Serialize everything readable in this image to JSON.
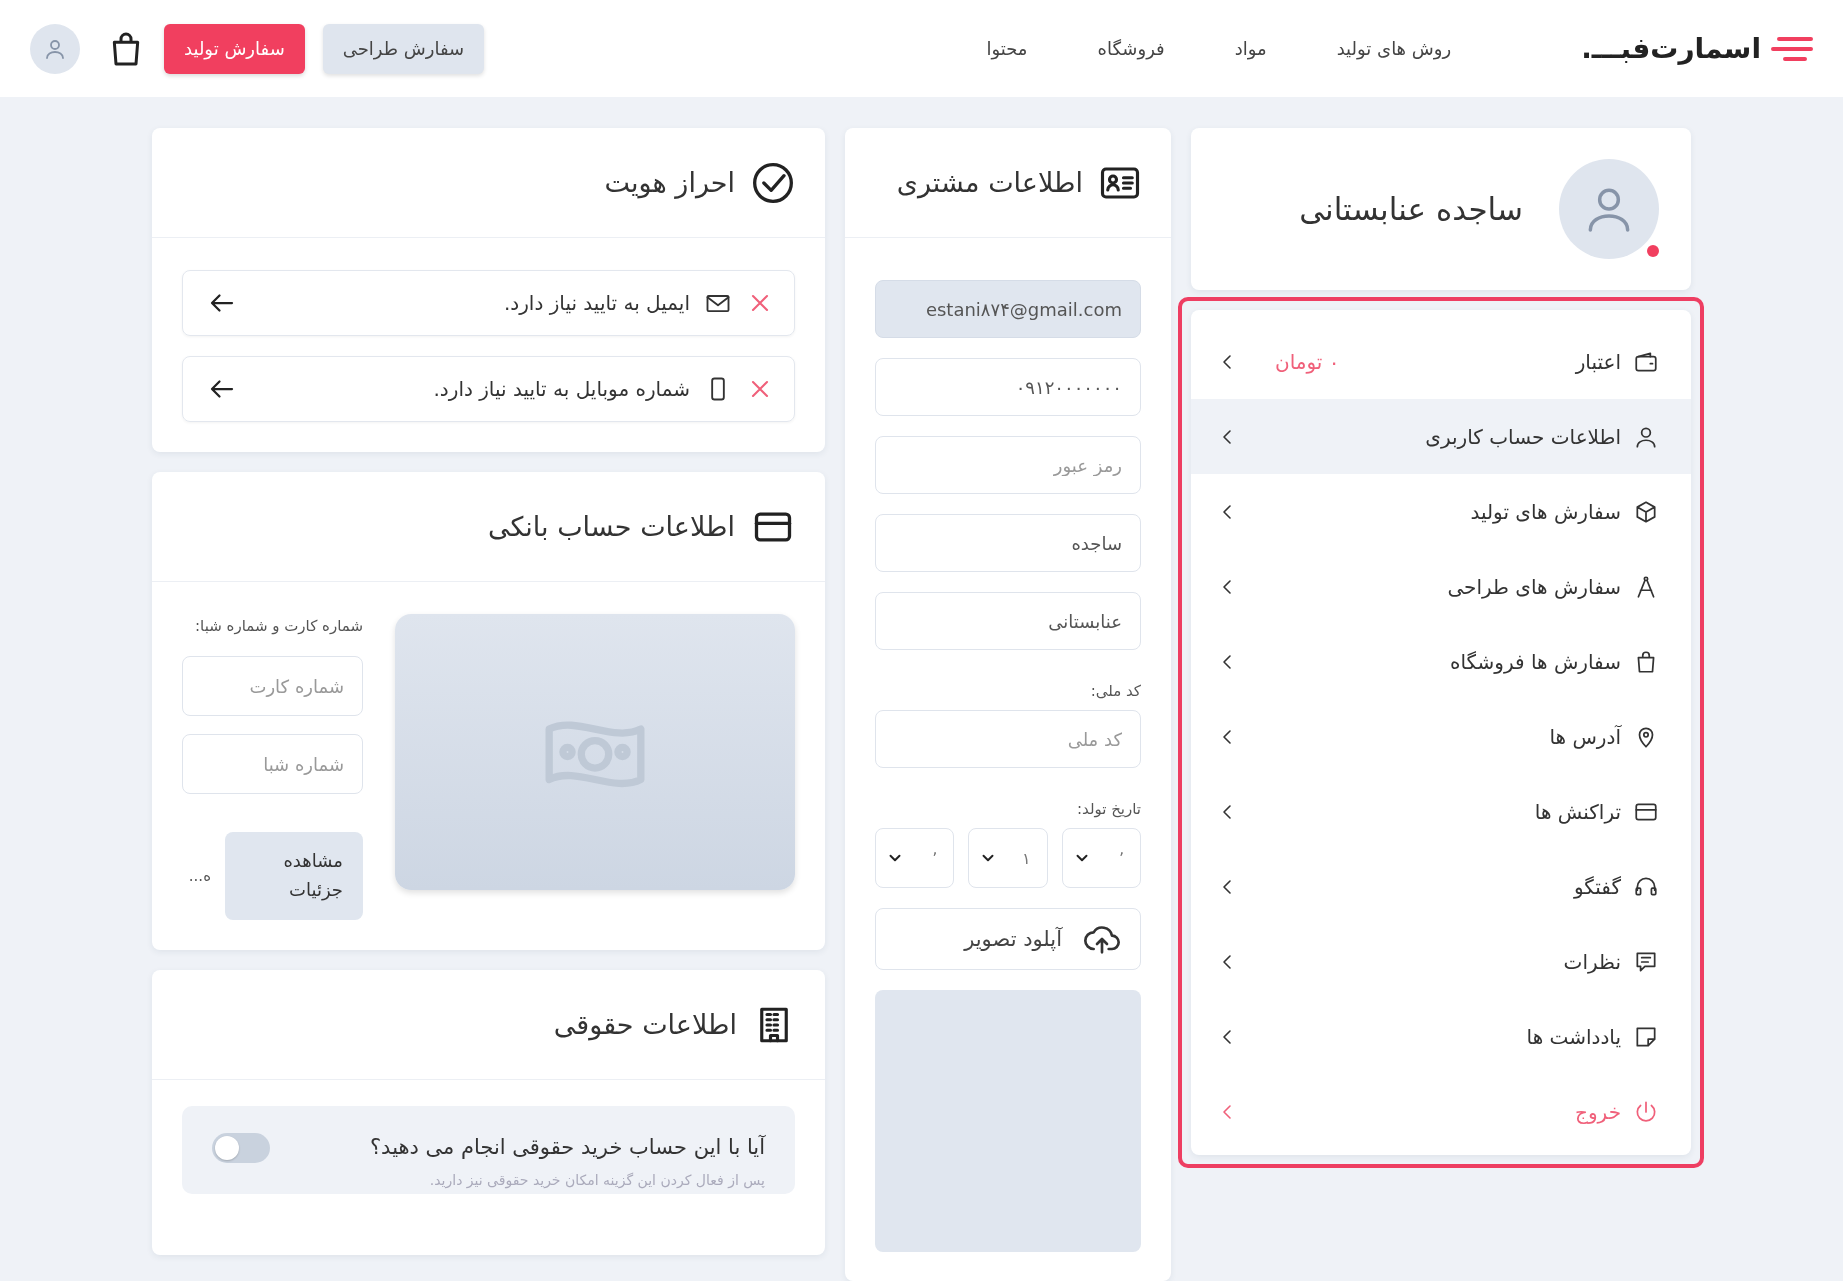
{
  "header": {
    "logo": "اسمارت‌فبـــ.",
    "nav": [
      "روش های تولید",
      "مواد",
      "فروشگاه",
      "محتوا"
    ],
    "buttons": [
      {
        "label": "سفارش طراحی",
        "kind": "secondary"
      },
      {
        "label": "سفارش تولید",
        "kind": "primary"
      }
    ]
  },
  "profile": {
    "name": "ساجده عنابستانی",
    "alert": true
  },
  "account_menu": {
    "highlighted": true,
    "items": [
      {
        "label": "اعتبار",
        "value": "۰ تومان",
        "selected": false,
        "kind": "normal"
      },
      {
        "label": "اطلاعات حساب کاربری",
        "selected": true,
        "kind": "normal"
      },
      {
        "label": "سفارش های تولید",
        "selected": false,
        "kind": "normal"
      },
      {
        "label": "سفارش های طراحی",
        "selected": false,
        "kind": "normal"
      },
      {
        "label": "سفارش ها فروشگاه",
        "selected": false,
        "kind": "normal"
      },
      {
        "label": "آدرس ها",
        "selected": false,
        "kind": "normal"
      },
      {
        "label": "تراکنش ها",
        "selected": false,
        "kind": "normal"
      },
      {
        "label": "گفتگو",
        "selected": false,
        "kind": "normal"
      },
      {
        "label": "نظرات",
        "selected": false,
        "kind": "normal"
      },
      {
        "label": "یادداشت ها",
        "selected": false,
        "kind": "normal"
      },
      {
        "label": "خروج",
        "selected": false,
        "kind": "logout"
      }
    ]
  },
  "customer_info": {
    "title": "اطلاعات مشتری",
    "fields": [
      {
        "value": "estani۸۷۴@gmail.com",
        "disabled": true
      },
      {
        "value": "۰۹۱۲۰۰۰۰۰۰۰",
        "disabled": false
      },
      {
        "placeholder": "رمز عبور",
        "disabled": false
      },
      {
        "value": "ساجده",
        "disabled": false
      },
      {
        "value": "عنابستانی",
        "disabled": false
      }
    ],
    "national_id": {
      "label": "کد ملی:",
      "placeholder": "کد ملی"
    },
    "birth_date": {
      "label": "تاریخ تولد:",
      "selects": [
        "٬",
        "۱",
        "٬"
      ]
    },
    "upload": {
      "label": "آپلود تصویر"
    }
  },
  "identity": {
    "title": "احراز هویت",
    "items": [
      {
        "text": "ایمیل به تایید نیاز دارد.",
        "verified": false
      },
      {
        "text": "شماره موبایل به تایید نیاز دارد.",
        "verified": false
      }
    ]
  },
  "bank": {
    "title": "اطلاعات حساب بانکی",
    "label": "شماره کارت و شماره شبا:",
    "fields": [
      {
        "placeholder": "شماره کارت"
      },
      {
        "placeholder": "شماره شبا"
      }
    ],
    "details_button": "مشاهده جزئیات",
    "more": "ه..."
  },
  "legal": {
    "title": "اطلاعات حقوقی",
    "question": "آیا با این حساب خرید حقوقی انجام می دهید؟",
    "on": false,
    "hint": "پس از فعال کردن این گزینه امکان خرید حقوقی نیز دارید."
  }
}
